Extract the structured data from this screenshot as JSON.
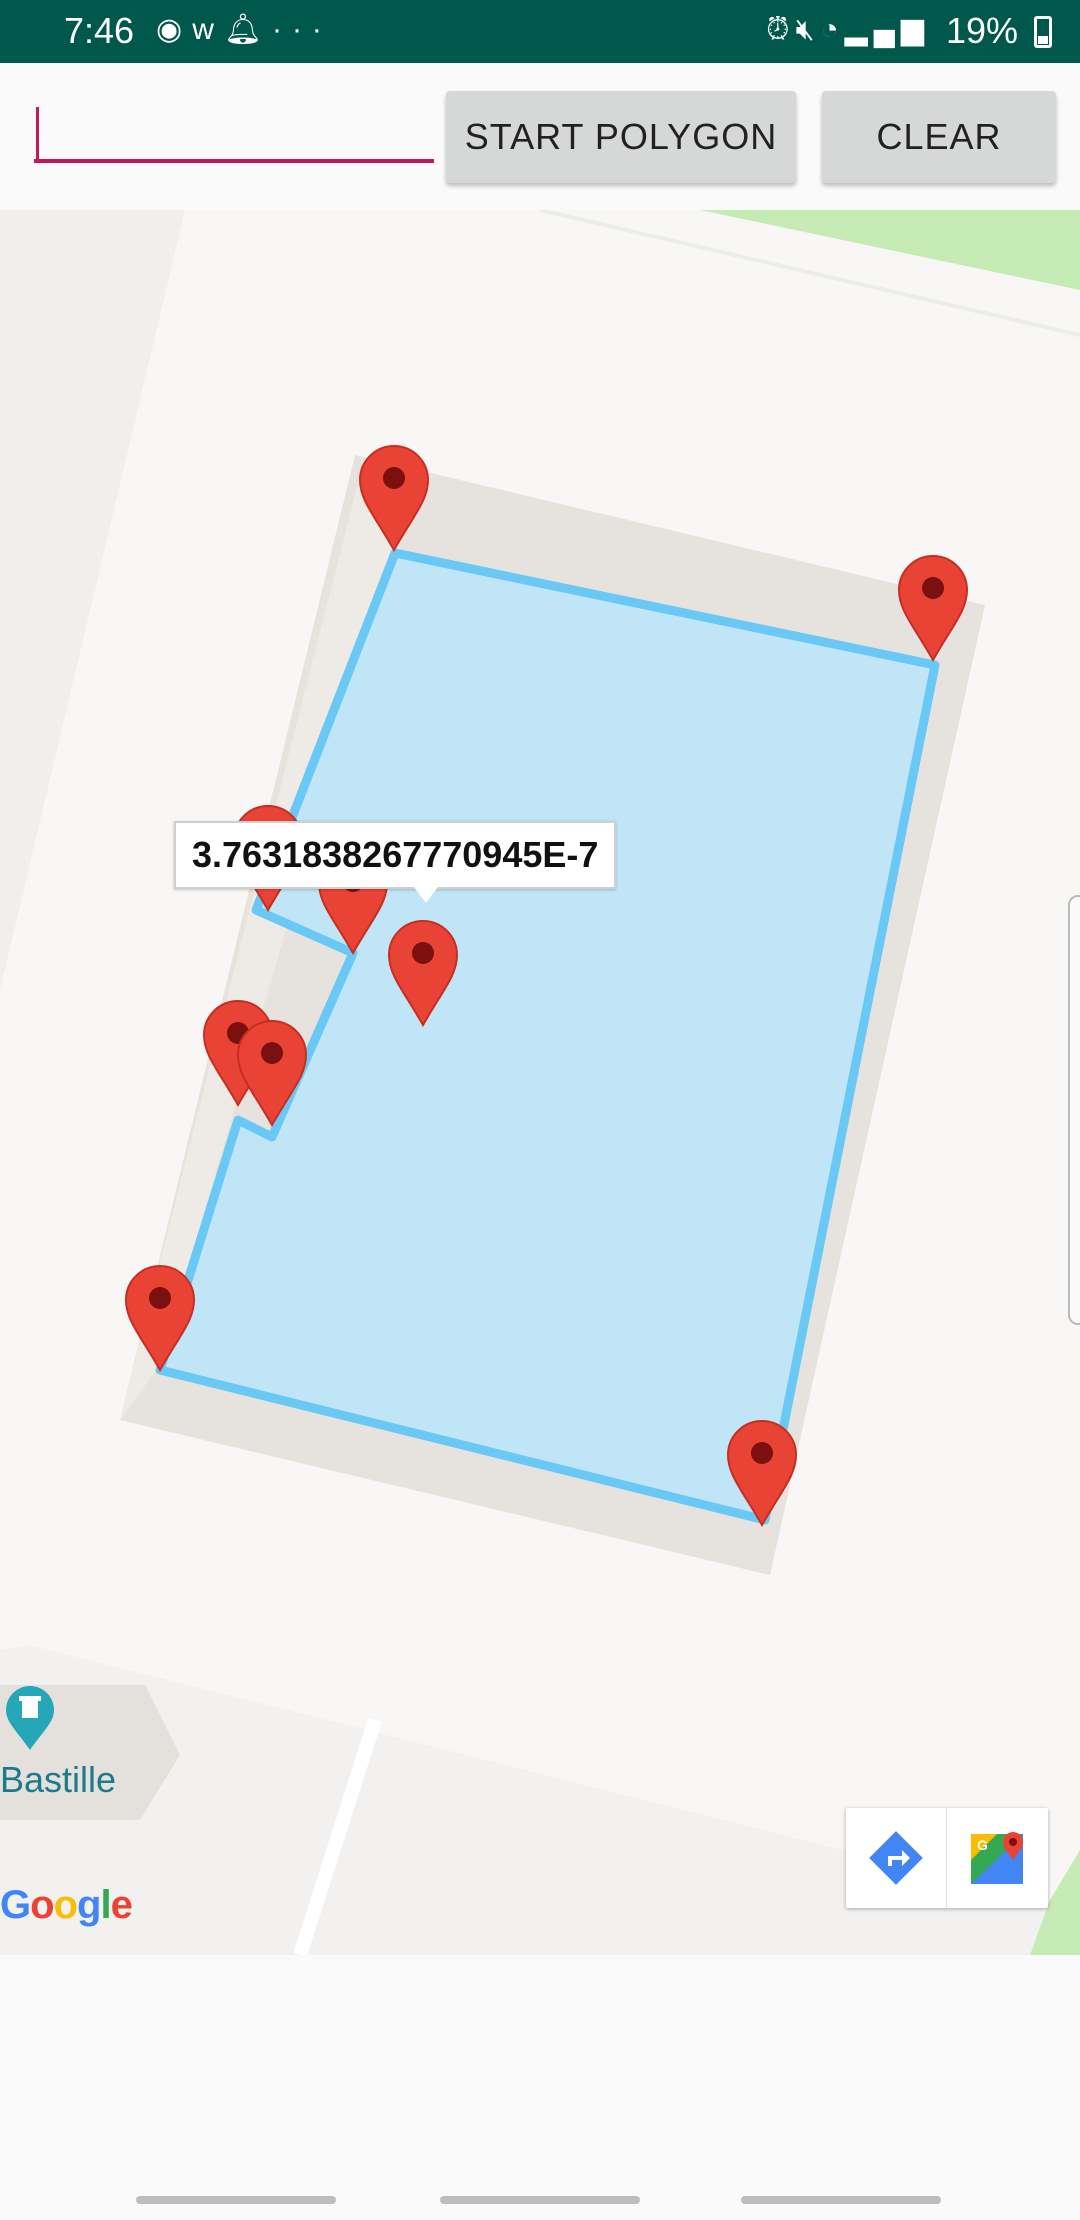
{
  "status_bar": {
    "time": "7:46",
    "left_icons": [
      "messenger-icon",
      "w-app-icon",
      "bell-icon",
      "more-icon"
    ],
    "right_icons": [
      "alarm-icon",
      "mute-icon",
      "wifi-icon",
      "signal-icon"
    ],
    "battery": "19%"
  },
  "toolbar": {
    "input_value": "",
    "input_placeholder": "",
    "start_polygon_label": "START POLYGON",
    "clear_label": "CLEAR"
  },
  "map": {
    "info_window_text": "3.7631838267770945E-7",
    "poi_label": "Bastille",
    "google_logo": "Google",
    "markers_count": 9,
    "colors": {
      "polygon_stroke": "#6ac8f5",
      "polygon_fill": "#bfe5f7",
      "marker": "#e94335",
      "marker_dot": "#7a1010",
      "building": "#e4e1dc",
      "park": "#c6ebb4"
    },
    "toolbar_icons": [
      "directions-icon",
      "google-maps-icon"
    ]
  },
  "nav_bar": {
    "items": [
      "recent-apps",
      "home",
      "back"
    ]
  }
}
